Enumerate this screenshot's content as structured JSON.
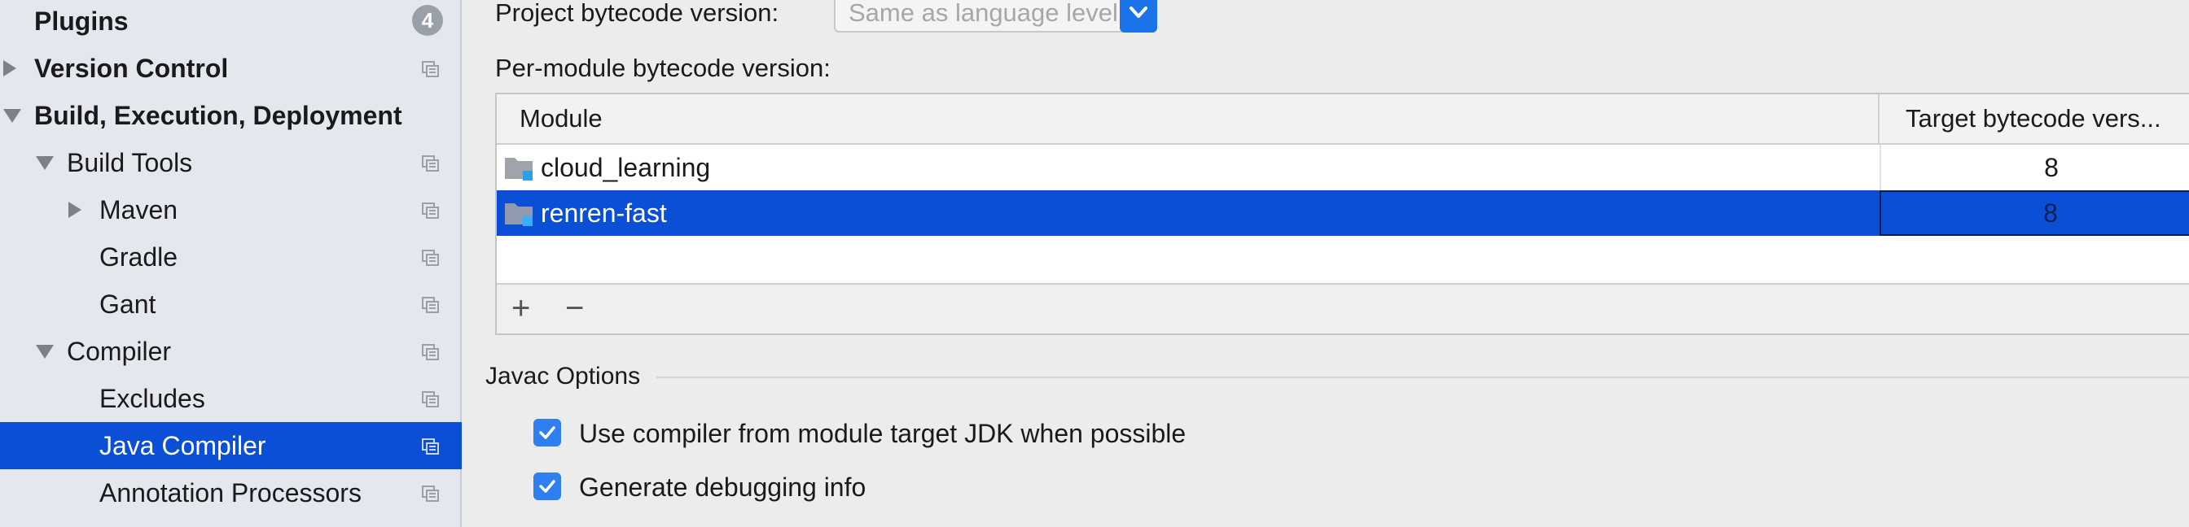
{
  "sidebar": {
    "items": [
      {
        "label": "Plugins",
        "badge": "4"
      },
      {
        "label": "Version Control"
      },
      {
        "label": "Build, Execution, Deployment"
      },
      {
        "label": "Build Tools"
      },
      {
        "label": "Maven"
      },
      {
        "label": "Gradle"
      },
      {
        "label": "Gant"
      },
      {
        "label": "Compiler"
      },
      {
        "label": "Excludes"
      },
      {
        "label": "Java Compiler"
      },
      {
        "label": "Annotation Processors"
      }
    ],
    "selected": "Java Compiler",
    "selection_color": "#0b4fd6"
  },
  "main": {
    "project_bytecode_label": "Project bytecode version:",
    "project_bytecode_value": "Same as language level",
    "per_module_label": "Per-module bytecode version:",
    "table": {
      "headers": [
        "Module",
        "Target bytecode vers..."
      ],
      "rows": [
        {
          "module": "cloud_learning",
          "target": "8"
        },
        {
          "module": "renren-fast",
          "target": "8"
        }
      ],
      "selected_row": "renren-fast",
      "add_label": "+",
      "remove_label": "−"
    },
    "javac_options": {
      "title": "Javac Options",
      "checkboxes": [
        {
          "label": "Use compiler from module target JDK when possible",
          "checked": true
        },
        {
          "label": "Generate debugging info",
          "checked": true
        }
      ]
    }
  },
  "icons": {
    "copy": "copy-settings-icon",
    "folder": "module-folder-icon",
    "expand": "chevron-right-icon",
    "collapse": "chevron-down-icon",
    "check": "checkmark-icon"
  },
  "colors": {
    "accent": "#1a73e8",
    "selection": "#0b4fd6",
    "sidebar_bg": "#e4e8ee"
  }
}
